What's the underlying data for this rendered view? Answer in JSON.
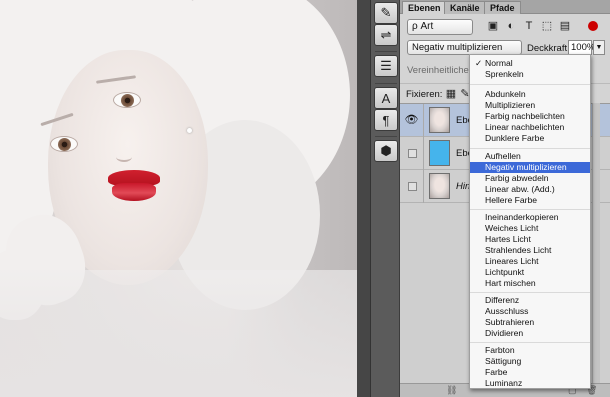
{
  "tabs": [
    "Ebenen",
    "Kanäle",
    "Pfade"
  ],
  "filter": {
    "kind_label": "ρ Art",
    "icons": [
      "image-filter-icon",
      "circle-half-icon",
      "text-filter-icon",
      "shape-filter-icon",
      "smart-object-icon"
    ]
  },
  "blend": {
    "current": "Negativ multiplizieren",
    "opacity_label": "Deckkraft:",
    "opacity_value": "100%"
  },
  "faded": {
    "unify": "Vereinheitlichen:",
    "fix": "Fixieren:"
  },
  "layers": [
    {
      "name": "Ebe",
      "thumb": "photo",
      "visible": true,
      "selected": true
    },
    {
      "name": "Ebe",
      "thumb": "blue",
      "visible": false,
      "selected": false
    },
    {
      "name": "Hin",
      "thumb": "photo",
      "visible": false,
      "selected": false
    }
  ],
  "menu": {
    "groups": [
      [
        "Normal",
        "Sprenkeln"
      ],
      [
        "Abdunkeln",
        "Multiplizieren",
        "Farbig nachbelichten",
        "Linear nachbelichten",
        "Dunklere Farbe"
      ],
      [
        "Aufhellen",
        "Negativ multiplizieren",
        "Farbig abwedeln",
        "Linear abw. (Add.)",
        "Hellere Farbe"
      ],
      [
        "Ineinanderkopieren",
        "Weiches Licht",
        "Hartes Licht",
        "Strahlendes Licht",
        "Lineares Licht",
        "Lichtpunkt",
        "Hart mischen"
      ],
      [
        "Differenz",
        "Ausschluss",
        "Subtrahieren",
        "Dividieren"
      ],
      [
        "Farbton",
        "Sättigung",
        "Farbe",
        "Luminanz"
      ]
    ],
    "checked": "Normal",
    "highlighted": "Negativ multiplizieren"
  },
  "tools": [
    "brush-settings-icon",
    "adjust-icon",
    "layer-comps-icon",
    "character-icon",
    "paragraph-icon",
    "3d-icon"
  ],
  "colors": {
    "menu_highlight": "#3c69d8",
    "layer_selected": "#b4c3db",
    "lip_red": "#c9172a",
    "blue_fill": "#45b4ec"
  }
}
